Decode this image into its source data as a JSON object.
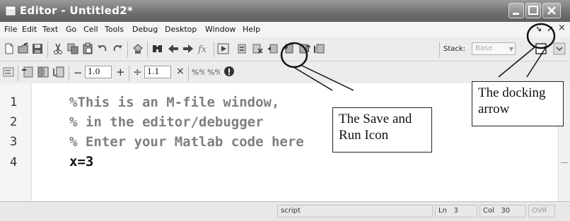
{
  "window": {
    "title": "Editor - Untitled2*"
  },
  "menu": {
    "items": [
      "File",
      "Edit",
      "Text",
      "Go",
      "Cell",
      "Tools",
      "Debug",
      "Desktop",
      "Window",
      "Help"
    ],
    "undock_down": "↘",
    "undock_up": "↗",
    "close": "×"
  },
  "toolbar": {
    "stack_label": "Stack:",
    "stack_value": "Base"
  },
  "cell_toolbar": {
    "minus": "−",
    "field1": "1.0",
    "plus": "+",
    "divide": "÷",
    "field2": "1.1",
    "times": "×"
  },
  "editor": {
    "lines": [
      {
        "num": "1",
        "text": "%This is an M-file window,"
      },
      {
        "num": "2",
        "text": "% in the editor/debugger"
      },
      {
        "num": "3",
        "text": "% Enter your Matlab code here"
      },
      {
        "num": "4",
        "text": "x=3"
      }
    ]
  },
  "status": {
    "mode": "script",
    "ln_label": "Ln",
    "ln_value": "3",
    "col_label": "Col",
    "col_value": "30",
    "ovr": "OVR"
  },
  "annotations": {
    "save_run": "The Save and Run Icon",
    "docking": "The docking arrow"
  },
  "colors": {
    "comment": "#7f7f7f",
    "titlebar": "#6e6e6e"
  }
}
